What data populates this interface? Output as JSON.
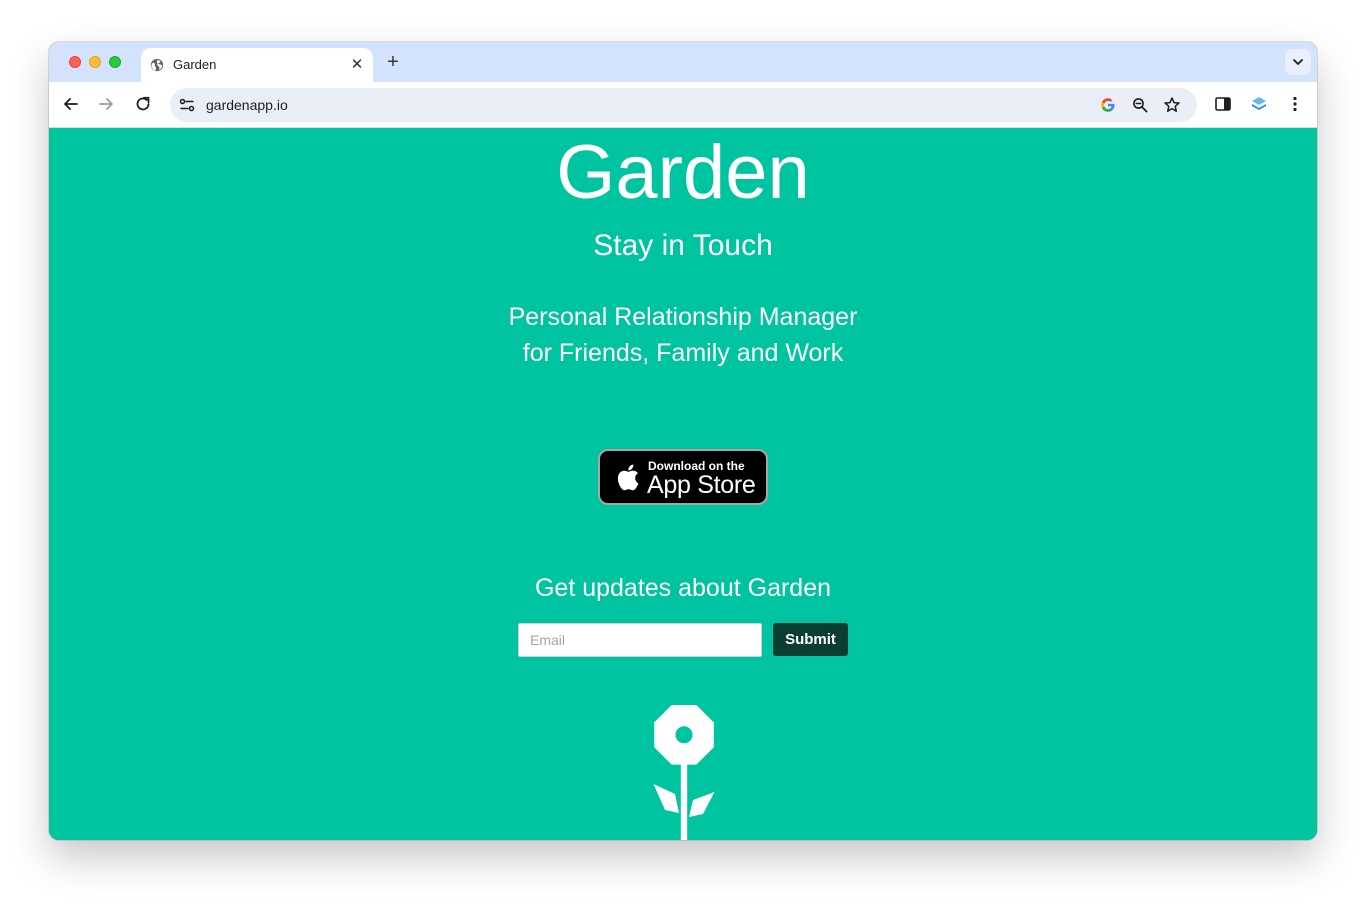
{
  "browser": {
    "tab": {
      "title": "Garden",
      "icon": "globe-icon"
    },
    "address_bar": {
      "url": "gardenapp.io"
    }
  },
  "page": {
    "title": "Garden",
    "tagline": "Stay in Touch",
    "description": "Personal Relationship Manager\nfor Friends, Family and Work",
    "app_store_badge": {
      "line1": "Download on the",
      "line2": "App Store"
    },
    "newsletter": {
      "heading": "Get updates about Garden",
      "email_placeholder": "Email",
      "email_value": "",
      "submit_label": "Submit"
    }
  },
  "colors": {
    "brand_background": "#00c4a0",
    "submit_button": "#0c3d31",
    "tab_strip": "#d3e3fd"
  }
}
